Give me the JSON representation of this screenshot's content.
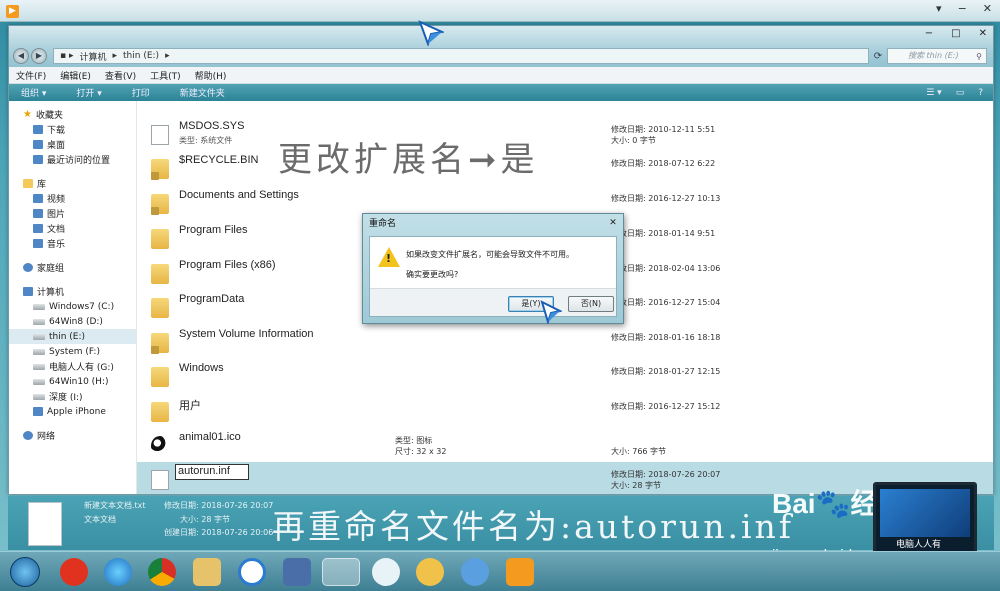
{
  "window": {
    "breadcrumb": [
      "计算机",
      "thin (E:)"
    ],
    "search_placeholder": "搜索 thin (E:)"
  },
  "menu": [
    "文件(F)",
    "编辑(E)",
    "查看(V)",
    "工具(T)",
    "帮助(H)"
  ],
  "toolbar": [
    "组织 ▾",
    "打开 ▾",
    "打印",
    "新建文件夹"
  ],
  "sidebar": {
    "favorites": "收藏夹",
    "fav_items": [
      "下载",
      "桌面",
      "最近访问的位置"
    ],
    "library": "库",
    "lib_items": [
      "视频",
      "图片",
      "文档",
      "音乐"
    ],
    "homegroup": "家庭组",
    "computer": "计算机",
    "drives": [
      "Windows7 (C:)",
      "64Win8 (D:)",
      "thin (E:)",
      "System (F:)",
      "电脑人人有 (G:)",
      "64Win10 (H:)",
      "深度 (I:)",
      "Apple iPhone"
    ],
    "selected_drive": "thin (E:)",
    "network": "网络"
  },
  "files": [
    {
      "name": "MSDOS.SYS",
      "sub": "类型: 系统文件",
      "date": "修改日期: 2010-12-11 5:51",
      "size": "大小: 0 字节"
    },
    {
      "name": "$RECYCLE.BIN",
      "date": "修改日期: 2018-07-12 6:22"
    },
    {
      "name": "Documents and Settings",
      "date": "修改日期: 2016-12-27 10:13"
    },
    {
      "name": "Program Files",
      "date": "修改日期: 2018-01-14 9:51"
    },
    {
      "name": "Program Files (x86)",
      "date": "修改日期: 2018-02-04 13:06"
    },
    {
      "name": "ProgramData",
      "date": "修改日期: 2016-12-27 15:04"
    },
    {
      "name": "System Volume Information",
      "date": "修改日期: 2018-01-16 18:18"
    },
    {
      "name": "Windows",
      "date": "修改日期: 2018-01-27 12:15"
    },
    {
      "name": "用户",
      "date": "修改日期: 2016-12-27 15:12"
    },
    {
      "name": "animal01.ico",
      "type": "类型: 图标",
      "dims": "尺寸: 32 x 32",
      "size": "大小: 766 字节"
    },
    {
      "name": "autorun.inf",
      "date": "修改日期: 2018-07-26 20:07",
      "size": "大小: 28 字节"
    }
  ],
  "annotation_top": "更改扩展名➞是",
  "annotation_bottom": "再重命名文件名为:autorun.inf",
  "dialog": {
    "title": "重命名",
    "close": "✕",
    "message": "如果改变文件扩展名，可能会导致文件不可用。",
    "question": "确实要更改吗?",
    "yes": "是(Y)",
    "no": "否(N)"
  },
  "details": {
    "name": "新建文本文档.txt",
    "type": "文本文档",
    "modified": "修改日期: 2018-07-26 20:07",
    "size": "大小: 28 字节",
    "created": "创建日期: 2018-07-26 20:06"
  },
  "watermark": {
    "brand": "Bai",
    "jy": "经验",
    "url": "jingyan.baidu.com",
    "caption": "电脑人人有"
  },
  "colors": {
    "accent": "#2a8396",
    "selection": "#b9dbe3",
    "warning": "#f3c31b"
  }
}
